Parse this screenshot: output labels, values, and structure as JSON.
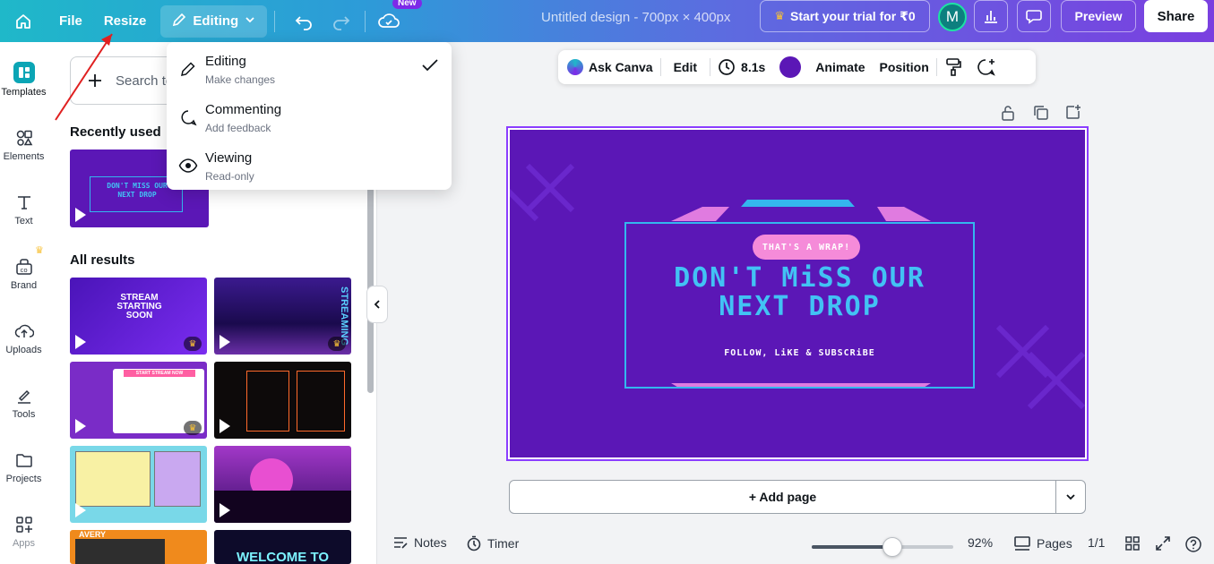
{
  "topbar": {
    "file_label": "File",
    "resize_label": "Resize",
    "editing_label": "Editing",
    "new_badge": "New",
    "design_title": "Untitled design - 700px × 400px",
    "trial_label": "Start your trial for ₹0",
    "avatar_initial": "M",
    "preview_label": "Preview",
    "share_label": "Share"
  },
  "rail": {
    "items": [
      {
        "label": "Templates",
        "icon": "templates-icon"
      },
      {
        "label": "Elements",
        "icon": "elements-icon"
      },
      {
        "label": "Text",
        "icon": "text-icon"
      },
      {
        "label": "Brand",
        "icon": "brand-icon"
      },
      {
        "label": "Uploads",
        "icon": "uploads-icon"
      },
      {
        "label": "Tools",
        "icon": "tools-icon"
      },
      {
        "label": "Projects",
        "icon": "projects-icon"
      },
      {
        "label": "Apps",
        "icon": "apps-icon"
      }
    ]
  },
  "panel": {
    "search_placeholder": "Search te",
    "recently_used": "Recently used",
    "all_results": "All results",
    "thumb_text": {
      "recent": "DON'T MISS OUR NEXT DROP",
      "t1": "STREAM STARTING SOON",
      "t2": "STREAMING",
      "t3": "START STREAM NOW",
      "t4": "",
      "t5": "",
      "t6": "",
      "t7": "AVERY",
      "t8": "WELCOME TO"
    }
  },
  "dropdown": {
    "items": [
      {
        "label": "Editing",
        "sub": "Make changes",
        "checked": true
      },
      {
        "label": "Commenting",
        "sub": "Add feedback",
        "checked": false
      },
      {
        "label": "Viewing",
        "sub": "Read-only",
        "checked": false
      }
    ]
  },
  "float_toolbar": {
    "ask_canva": "Ask Canva",
    "edit": "Edit",
    "duration": "8.1s",
    "color": "#5b17b6",
    "animate": "Animate",
    "position": "Position"
  },
  "design": {
    "pill": "THAT'S A WRAP!",
    "headline_1": "DON'T MiSS OUR",
    "headline_2": "NEXT DROP",
    "follow": "FOLLOW, LiKE & SUBSCRiBE"
  },
  "add_page_label": "+ Add page",
  "bottom": {
    "notes": "Notes",
    "timer": "Timer",
    "zoom": "92%",
    "zoom_level": 0.57,
    "pages": "Pages",
    "page_count": "1/1"
  },
  "colors": {
    "accent": "#8b3dff",
    "design_bg": "#5b17b6",
    "headline": "#42c2f4",
    "pill": "#f58bd9"
  }
}
